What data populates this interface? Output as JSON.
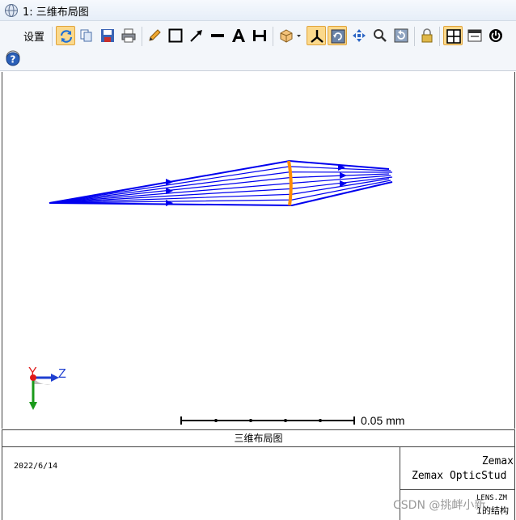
{
  "window": {
    "title": "1: 三维布局图"
  },
  "toolbar": {
    "settings_label": "设置",
    "buttons": [
      {
        "name": "update-button",
        "icon": "refresh-icon"
      },
      {
        "name": "copy-button",
        "icon": "copy-icon"
      },
      {
        "name": "save-button",
        "icon": "save-icon"
      },
      {
        "name": "print-button",
        "icon": "printer-icon"
      },
      {
        "name": "pencil-tool",
        "icon": "pencil-icon"
      },
      {
        "name": "rectangle-tool",
        "icon": "rectangle-icon"
      },
      {
        "name": "arrow-tool",
        "icon": "arrow-icon"
      },
      {
        "name": "line-tool",
        "icon": "line-icon"
      },
      {
        "name": "text-tool",
        "icon": "text-icon"
      },
      {
        "name": "dimension-tool",
        "icon": "dimension-icon"
      },
      {
        "name": "view-orientation-dropdown",
        "icon": "orientation-icon"
      },
      {
        "name": "axes-toggle",
        "icon": "axes-icon"
      },
      {
        "name": "rotate-button",
        "icon": "rotate-icon"
      },
      {
        "name": "pan-button",
        "icon": "pan-icon"
      },
      {
        "name": "zoom-button",
        "icon": "zoom-icon"
      },
      {
        "name": "reset-view-button",
        "icon": "reset-icon"
      },
      {
        "name": "lock-button",
        "icon": "lock-icon"
      },
      {
        "name": "layout-grid-button",
        "icon": "grid-icon"
      },
      {
        "name": "window-button",
        "icon": "window-icon"
      },
      {
        "name": "power-button",
        "icon": "power-icon"
      },
      {
        "name": "help-button",
        "icon": "help-icon"
      }
    ]
  },
  "plot": {
    "scale_label": "0.05 mm",
    "axis_labels": {
      "y": "Y",
      "z": "Z"
    },
    "ray_color": "#0000ee",
    "lens_color": "#ff8c00"
  },
  "caption": "三维布局图",
  "info": {
    "date": "2022/6/14",
    "company": "Zemax",
    "product": "Zemax OpticStud",
    "lens_file": "LENS.ZM",
    "config_label": "1的结构"
  },
  "watermark": "CSDN @挑衅小新"
}
